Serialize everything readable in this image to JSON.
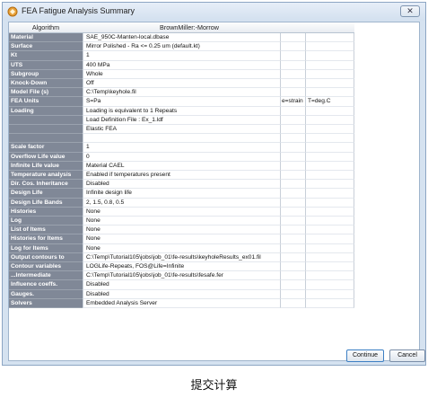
{
  "window": {
    "title": "FEA Fatigue Analysis Summary",
    "close_label": "✕"
  },
  "grid": {
    "header_algorithm": "Algorithm",
    "header_value": "BrownMiller:-Morrow",
    "rows": [
      {
        "label": "Material",
        "value": "SAE_950C-Manten-local.dbase",
        "c3": "",
        "c4": ""
      },
      {
        "label": "Surface",
        "value": "Mirror Polished - Ra <= 0.25 um (default.kt)",
        "c3": "",
        "c4": ""
      },
      {
        "label": "Kt",
        "value": "1",
        "c3": "",
        "c4": ""
      },
      {
        "label": "UTS",
        "value": "400 MPa",
        "c3": "",
        "c4": ""
      },
      {
        "label": "Subgroup",
        "value": "Whole",
        "c3": "",
        "c4": ""
      },
      {
        "label": "Knock-Down",
        "value": "Off",
        "c3": "",
        "c4": ""
      },
      {
        "label": "Model File (s)",
        "value": "C:\\Temp\\keyhole.fil",
        "c3": "",
        "c4": ""
      },
      {
        "label": "FEA Units",
        "value": "S=Pa",
        "c3": "e=strain",
        "c4": "T=deg.C"
      },
      {
        "label": "Loading",
        "value": "Loading is equivalent to 1 Repeats",
        "c3": "",
        "c4": ""
      },
      {
        "label": "",
        "value": "Load Definition File : Ex_1.ldf",
        "c3": "",
        "c4": ""
      },
      {
        "label": "",
        "value": "Elastic FEA",
        "c3": "",
        "c4": ""
      },
      {
        "label": "",
        "value": "",
        "c3": "",
        "c4": ""
      },
      {
        "label": "Scale factor",
        "value": "1",
        "c3": "",
        "c4": ""
      },
      {
        "label": "Overflow Life value",
        "value": "0",
        "c3": "",
        "c4": ""
      },
      {
        "label": "Infinite Life value",
        "value": "Material CAEL",
        "c3": "",
        "c4": ""
      },
      {
        "label": "Temperature analysis",
        "value": "Enabled if temperatures present",
        "c3": "",
        "c4": ""
      },
      {
        "label": "Dir. Cos. Inheritance",
        "value": "Disabled",
        "c3": "",
        "c4": ""
      },
      {
        "label": "Design Life",
        "value": "Infinite design life",
        "c3": "",
        "c4": ""
      },
      {
        "label": "Design Life Bands",
        "value": "2, 1.5, 0.8, 0.5",
        "c3": "",
        "c4": ""
      },
      {
        "label": "Histories",
        "value": "None",
        "c3": "",
        "c4": ""
      },
      {
        "label": "Log",
        "value": "None",
        "c3": "",
        "c4": ""
      },
      {
        "label": "List of Items",
        "value": "None",
        "c3": "",
        "c4": ""
      },
      {
        "label": "Histories for Items",
        "value": "None",
        "c3": "",
        "c4": ""
      },
      {
        "label": "Log for Items",
        "value": "None",
        "c3": "",
        "c4": ""
      },
      {
        "label": "Output contours to",
        "value": "C:\\Temp\\Tutorial105\\jobs\\job_01\\fe-results\\keyholeResults_ex01.fil",
        "c3": "",
        "c4": ""
      },
      {
        "label": "Contour variables",
        "value": "LOGLife-Repeats, FOS@Life=Infinite",
        "c3": "",
        "c4": ""
      },
      {
        "label": "...Intermediate",
        "value": "C:\\Temp\\Tutorial105\\jobs\\job_01\\fe-results\\fesafe.fer",
        "c3": "",
        "c4": ""
      },
      {
        "label": "Influence coeffs.",
        "value": "Disabled",
        "c3": "",
        "c4": ""
      },
      {
        "label": "Gauges.",
        "value": "Disabled",
        "c3": "",
        "c4": ""
      },
      {
        "label": "Solvers",
        "value": "Embedded Analysis Server",
        "c3": "",
        "c4": ""
      }
    ]
  },
  "buttons": {
    "continue_label": "Continue",
    "cancel_label": "Cancel"
  },
  "caption": "提交计算",
  "colors": {
    "label_bg": "#808897",
    "window_bg": "#d5e2f0",
    "accent": "#3c7fc4"
  }
}
